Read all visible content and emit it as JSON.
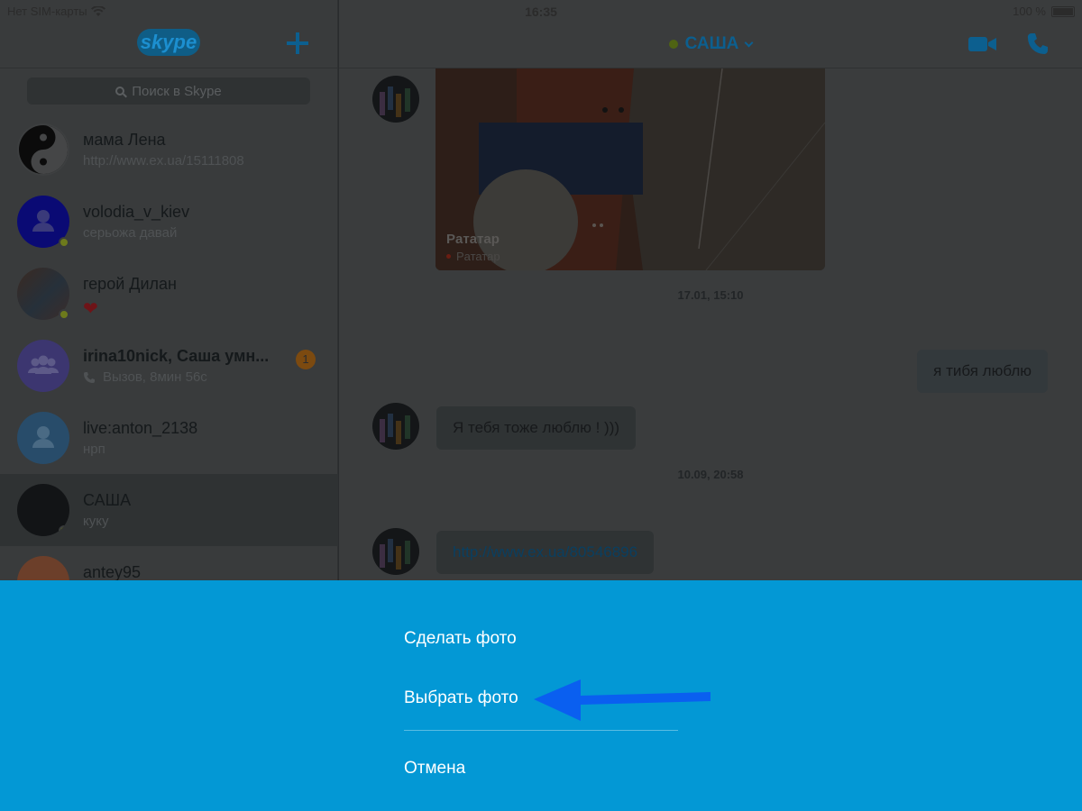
{
  "status_bar": {
    "carrier": "Нет SIM-карты",
    "time": "16:35",
    "battery": "100 %"
  },
  "sidebar": {
    "logo": "skype",
    "search_placeholder": "Поиск в Skype",
    "contacts": [
      {
        "name": "мама Лена",
        "sub": "http://www.ex.ua/15111808",
        "avatar": "yin-yang",
        "online": false
      },
      {
        "name": "volodia_v_kiev",
        "sub": "серьожа давай",
        "avatar": "default-person",
        "online": true
      },
      {
        "name": "герой Дилан",
        "sub": "❤",
        "avatar": "photo",
        "online": true
      },
      {
        "name": "irina10nick, Саша умн...",
        "sub": "Вызов, 8мин 56с",
        "avatar": "group",
        "online": false,
        "unread": "1"
      },
      {
        "name": "live:anton_2138",
        "sub": "нрп",
        "avatar": "default-person",
        "online": false
      },
      {
        "name": "САША",
        "sub": "куку",
        "avatar": "city-photo",
        "online": true,
        "selected": true
      },
      {
        "name": "antey95",
        "sub": "",
        "avatar": "default-person",
        "online": false
      }
    ]
  },
  "chat": {
    "title": "САША",
    "media": {
      "title": "Pататар",
      "subtitle": "Pататар"
    },
    "timestamps": [
      "17.01, 15:10",
      "10.09, 20:58"
    ],
    "messages": [
      {
        "text": "я тибя люблю",
        "direction": "out"
      },
      {
        "text": "Я тебя тоже люблю ! )))",
        "direction": "in"
      },
      {
        "text": "http://www.ex.ua/80546896",
        "direction": "in",
        "link": true
      }
    ]
  },
  "action_sheet": {
    "take_photo": "Сделать фото",
    "choose_photo": "Выбрать фото",
    "cancel": "Отмена"
  },
  "colors": {
    "sheet_bg": "#0398d5",
    "arrow": "#0a5ff0"
  }
}
